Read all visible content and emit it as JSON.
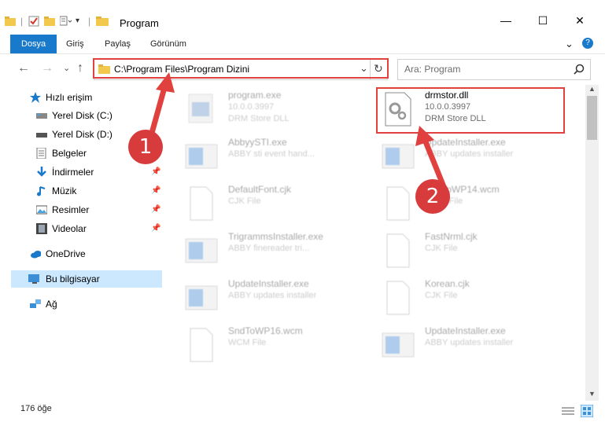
{
  "window": {
    "title": "Program",
    "minimize": "—",
    "maximize": "☐",
    "close": "✕"
  },
  "ribbon": {
    "tabs": [
      "Dosya",
      "Giriş",
      "Paylaş",
      "Görünüm"
    ],
    "expand": "⌄",
    "help": "?"
  },
  "address": {
    "path": "C:\\Program Files\\Program Dizini",
    "dropdown": "⌄",
    "refresh": "↻"
  },
  "search": {
    "placeholder": "Ara: Program"
  },
  "nav": {
    "back": "←",
    "forward": "→",
    "recent": "⌄",
    "up": "↑"
  },
  "sidebar": {
    "items": [
      {
        "label": "Hızlı erişim",
        "icon": "star-icon"
      },
      {
        "label": "Yerel Disk (C:)",
        "icon": "drive-icon"
      },
      {
        "label": "Yerel Disk (D:)",
        "icon": "drive-icon"
      },
      {
        "label": "Belgeler",
        "icon": "documents-icon"
      },
      {
        "label": "İndirmeler",
        "icon": "download-icon"
      },
      {
        "label": "Müzik",
        "icon": "music-icon"
      },
      {
        "label": "Resimler",
        "icon": "pictures-icon"
      },
      {
        "label": "Videolar",
        "icon": "video-icon"
      },
      {
        "label": "OneDrive",
        "icon": "cloud-icon"
      },
      {
        "label": "Bu bilgisayar",
        "icon": "computer-icon"
      },
      {
        "label": "Ağ",
        "icon": "network-icon"
      }
    ]
  },
  "files": [
    {
      "name": "program.exe",
      "line2": "10.0.0.3997",
      "line3": "DRM Store DLL",
      "icon": "exe-icon"
    },
    {
      "name": "drmstor.dll",
      "line2": "10.0.0.3997",
      "line3": "DRM Store DLL",
      "icon": "dll-icon"
    },
    {
      "name": "AbbyySTI.exe",
      "line2": "ABBY sti event hand...",
      "line3": "",
      "icon": "exe-icon"
    },
    {
      "name": "UpdateInstaller.exe",
      "line2": "ABBY updates installer",
      "line3": "",
      "icon": "exe-icon"
    },
    {
      "name": "DefaultFont.cjk",
      "line2": "CJK File",
      "line3": "",
      "icon": "file-icon"
    },
    {
      "name": "SndToWP14.wcm",
      "line2": "WCM File",
      "line3": "",
      "icon": "file-icon"
    },
    {
      "name": "TrigrammsInstaller.exe",
      "line2": "ABBY finereader tri...",
      "line3": "",
      "icon": "exe-icon"
    },
    {
      "name": "FastNrml.cjk",
      "line2": "CJK File",
      "line3": "",
      "icon": "file-icon"
    },
    {
      "name": "UpdateInstaller.exe",
      "line2": "ABBY updates installer",
      "line3": "",
      "icon": "exe-icon"
    },
    {
      "name": "Korean.cjk",
      "line2": "CJK File",
      "line3": "",
      "icon": "file-icon"
    },
    {
      "name": "SndToWP16.wcm",
      "line2": "WCM File",
      "line3": "",
      "icon": "file-icon"
    },
    {
      "name": "UpdateInstaller.exe",
      "line2": "ABBY updates installer",
      "line3": "",
      "icon": "exe-icon"
    }
  ],
  "annotations": {
    "step1": "1",
    "step2": "2",
    "color": "#e0413f"
  },
  "status": {
    "count": "176 öğe"
  },
  "colors": {
    "accent": "#1979ca",
    "selection": "#cce8ff"
  }
}
